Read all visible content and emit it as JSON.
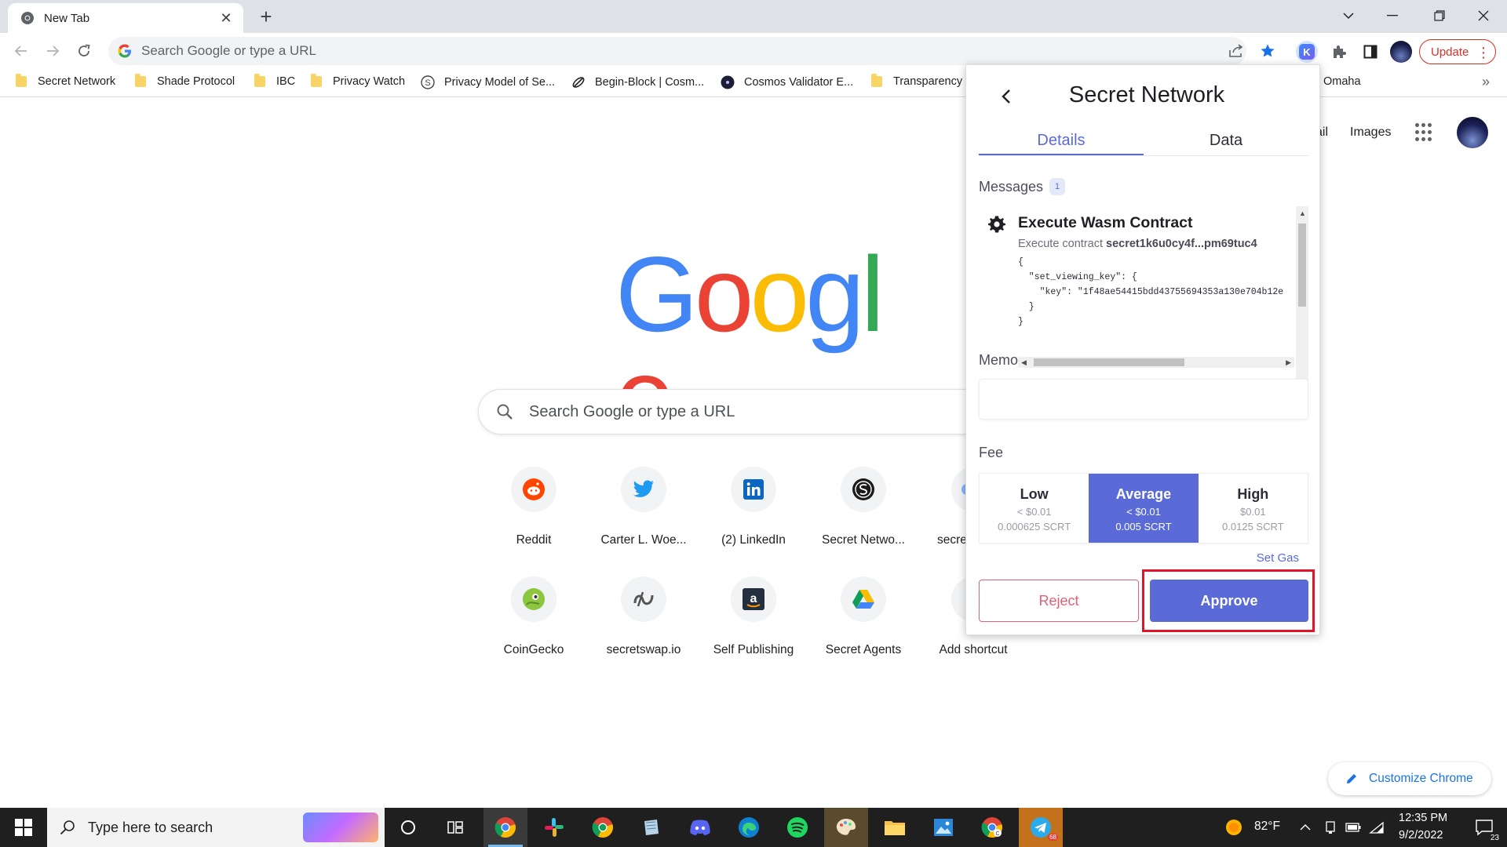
{
  "browser": {
    "tab_title": "New Tab",
    "omnibox_placeholder": "Search Google or type a URL",
    "update_label": "Update"
  },
  "bookmarks": [
    {
      "label": "Secret Network",
      "icon": "folder-icon"
    },
    {
      "label": "Shade Protocol",
      "icon": "folder-icon"
    },
    {
      "label": "IBC",
      "icon": "folder-icon"
    },
    {
      "label": "Privacy Watch",
      "icon": "folder-icon"
    },
    {
      "label": "Privacy Model of Se...",
      "icon": "secret-s-icon"
    },
    {
      "label": "Begin-Block | Cosm...",
      "icon": "begin-block-icon"
    },
    {
      "label": "Cosmos Validator E...",
      "icon": "cosmos-icon"
    },
    {
      "label": "Transparency R",
      "icon": "folder-icon"
    },
    {
      "label": "Omaha",
      "icon": "none"
    }
  ],
  "google": {
    "header_links": [
      "ail",
      "Images"
    ],
    "search_placeholder": "Search Google or type a URL",
    "logo_letters": [
      "G",
      "o",
      "o",
      "g",
      "l",
      "e"
    ],
    "logo_colors": [
      "#4285f4",
      "#ea4335",
      "#fbbc05",
      "#4285f4",
      "#34a853",
      "#ea4335"
    ],
    "shortcuts_row1": [
      {
        "label": "Reddit",
        "icon": "reddit-icon"
      },
      {
        "label": "Carter L. Woe...",
        "icon": "twitter-icon"
      },
      {
        "label": "(2) LinkedIn",
        "icon": "linkedin-icon"
      },
      {
        "label": "Secret Netwo...",
        "icon": "secret-network-icon"
      },
      {
        "label": "secre",
        "icon": "partial-icon"
      }
    ],
    "shortcuts_row2": [
      {
        "label": "CoinGecko",
        "icon": "coingecko-icon"
      },
      {
        "label": "secretswap.io",
        "icon": "secretswap-icon"
      },
      {
        "label": "Self Publishing",
        "icon": "amazon-icon"
      },
      {
        "label": "Secret Agents",
        "icon": "google-drive-icon"
      },
      {
        "label": "Add shortcut",
        "icon": "plus-icon"
      }
    ],
    "customize_label": "Customize Chrome"
  },
  "popup": {
    "title": "Secret Network",
    "tabs": [
      "Details",
      "Data"
    ],
    "active_tab": "Details",
    "messages_label": "Messages",
    "messages_count": "1",
    "message": {
      "title": "Execute Wasm Contract",
      "subtitle_prefix": "Execute contract ",
      "contract": "secret1k6u0cy4f...pm69tuc4",
      "code": "{\n  \"set_viewing_key\": {\n    \"key\": \"1f48ae54415bdd43755694353a130e704b12e\n  }\n}"
    },
    "memo_label": "Memo",
    "memo_value": "",
    "fee_label": "Fee",
    "fees": [
      {
        "name": "Low",
        "usd": "< $0.01",
        "scrt": "0.000625 SCRT",
        "selected": false
      },
      {
        "name": "Average",
        "usd": "< $0.01",
        "scrt": "0.005 SCRT",
        "selected": true
      },
      {
        "name": "High",
        "usd": "$0.01",
        "scrt": "0.0125 SCRT",
        "selected": false
      }
    ],
    "set_gas_label": "Set Gas",
    "reject_label": "Reject",
    "approve_label": "Approve",
    "accent_color": "#5a6bd8",
    "reject_color": "#e0607a",
    "highlight_color": "#e0142a"
  },
  "taskbar": {
    "search_placeholder": "Type here to search",
    "weather": "82°F",
    "time": "12:35 PM",
    "date": "9/2/2022",
    "notification_count": "23",
    "telegram_badge": "68",
    "apps": [
      "cortana-icon",
      "task-view-icon",
      "chrome-icon",
      "slack-icon",
      "chrome-green-icon",
      "notebook-icon",
      "discord-icon",
      "edge-icon",
      "spotify-icon",
      "paint-icon",
      "file-explorer-icon",
      "photos-icon",
      "chrome-profile-icon",
      "telegram-icon"
    ]
  }
}
